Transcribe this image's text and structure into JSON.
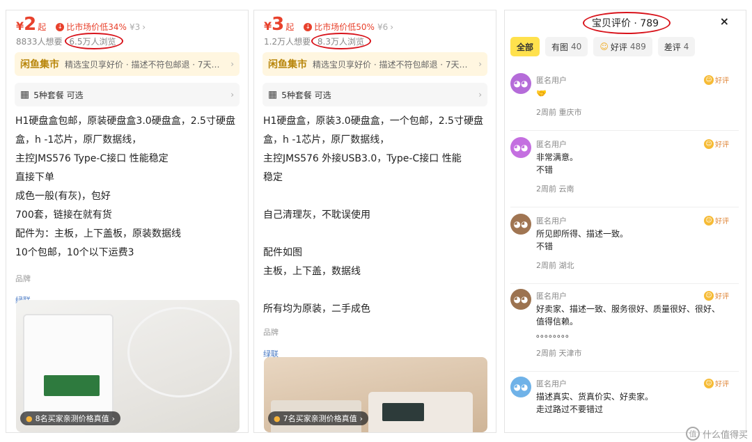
{
  "listing1": {
    "currency": "¥",
    "price": "2",
    "price_suffix": "起",
    "compare_text": "比市场价低34%",
    "compare_old": "¥3",
    "wants": "8833人想要",
    "views": "6.5万人浏览",
    "banner_logo": "闲鱼集市",
    "banner_text": "精选宝贝享好价 · 描述不符包邮退 · 7天…",
    "plans": "5种套餐 可选",
    "desc": [
      "H1硬盘盒包邮，原装硬盘盒3.0硬盘盒，2.5寸硬盘",
      "盒，h -1芯片，原厂数据线，",
      "主控JMS576    Type-C接口  性能稳定",
      " 直接下单",
      "成色一般(有灰)，包好",
      "700套，链接在就有货",
      "配件为：主板，上下盖板，原装数据线",
      "10个包邮，10个以下运费3"
    ],
    "brand_key": "品牌",
    "brand_value": "绿联",
    "verify": "8名买家亲测价格真值"
  },
  "listing2": {
    "currency": "¥",
    "price": "3",
    "price_suffix": "起",
    "compare_text": "比市场价低50%",
    "compare_old": "¥6",
    "wants": "1.2万人想要",
    "views": "8.3万人浏览",
    "banner_logo": "闲鱼集市",
    "banner_text": "精选宝贝享好价 · 描述不符包邮退 · 7天…",
    "plans": "5种套餐 可选",
    "desc": [
      "H1硬盘盒，原装3.0硬盘盒，一个包邮，2.5寸硬盘",
      "盒，h -1芯片，原厂数据线，",
      "主控JMS576    外接USB3.0，Type-C接口  性能",
      "稳定",
      "",
      "自己清理灰，不耽误使用",
      "",
      "配件如图",
      "主板，上下盖，数据线",
      "",
      "所有均为原装，二手成色"
    ],
    "brand_key": "品牌",
    "brand_value": "绿联",
    "verify": "7名买家亲测价格真值"
  },
  "reviews": {
    "title": "宝贝评价 · 789",
    "close": "×",
    "filters": [
      {
        "label": "全部",
        "count": ""
      },
      {
        "label": "有图",
        "count": "40"
      },
      {
        "label": "好评",
        "count": "489"
      },
      {
        "label": "差评",
        "count": "4"
      }
    ],
    "items": [
      {
        "user": "匿名用户",
        "badge": "好评",
        "lines": [
          "🤝"
        ],
        "meta": "2周前  重庆市",
        "avatar_color": "#b56cd9"
      },
      {
        "user": "匿名用户",
        "badge": "好评",
        "lines": [
          "非常满意。",
          "不错"
        ],
        "meta": "2周前  云南",
        "avatar_color": "#c46fe0"
      },
      {
        "user": "匿名用户",
        "badge": "好评",
        "lines": [
          "所见即所得、描述一致。",
          "不错"
        ],
        "meta": "2周前  湖北",
        "avatar_color": "#a07552"
      },
      {
        "user": "匿名用户",
        "badge": "好评",
        "lines": [
          "好卖家、描述一致、服务很好、质量很好、很好、",
          "值得信赖。",
          "。。。。。。。。"
        ],
        "meta": "2周前  天津市",
        "avatar_color": "#9c7350"
      },
      {
        "user": "匿名用户",
        "badge": "好评",
        "lines": [
          "描述真实、货真价实、好卖家。",
          "走过路过不要错过"
        ],
        "meta": "",
        "avatar_color": "#6fb2e8"
      }
    ]
  },
  "watermark": "什么值得买"
}
